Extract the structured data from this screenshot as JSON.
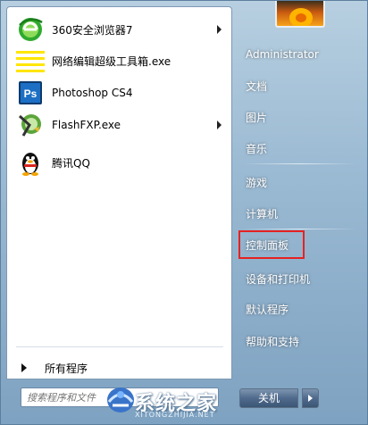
{
  "programs": [
    {
      "label": "360安全浏览器7",
      "icon": "ie-green-icon",
      "has_submenu": true
    },
    {
      "label": "网络编辑超级工具箱.exe",
      "icon": "yellow-stripes-icon",
      "has_submenu": false
    },
    {
      "label": "Photoshop CS4",
      "icon": "photoshop-icon",
      "has_submenu": false
    },
    {
      "label": "FlashFXP.exe",
      "icon": "flashfxp-icon",
      "has_submenu": true
    },
    {
      "label": "腾讯QQ",
      "icon": "qq-penguin-icon",
      "has_submenu": false
    }
  ],
  "all_programs_label": "所有程序",
  "search": {
    "placeholder": "搜索程序和文件"
  },
  "right_items": [
    {
      "label": "Administrator"
    },
    {
      "label": "文档"
    },
    {
      "label": "图片"
    },
    {
      "label": "音乐"
    },
    {
      "label": "游戏"
    },
    {
      "label": "计算机"
    },
    {
      "label": "控制面板"
    },
    {
      "label": "设备和打印机"
    },
    {
      "label": "默认程序"
    },
    {
      "label": "帮助和支持"
    }
  ],
  "shutdown_label": "关机",
  "watermark": {
    "title": "系统之家",
    "subtitle": "XITONGZHIJIA.NET"
  },
  "colors": {
    "highlight_border": "#e52222",
    "menu_glass": "#9bbad3"
  }
}
